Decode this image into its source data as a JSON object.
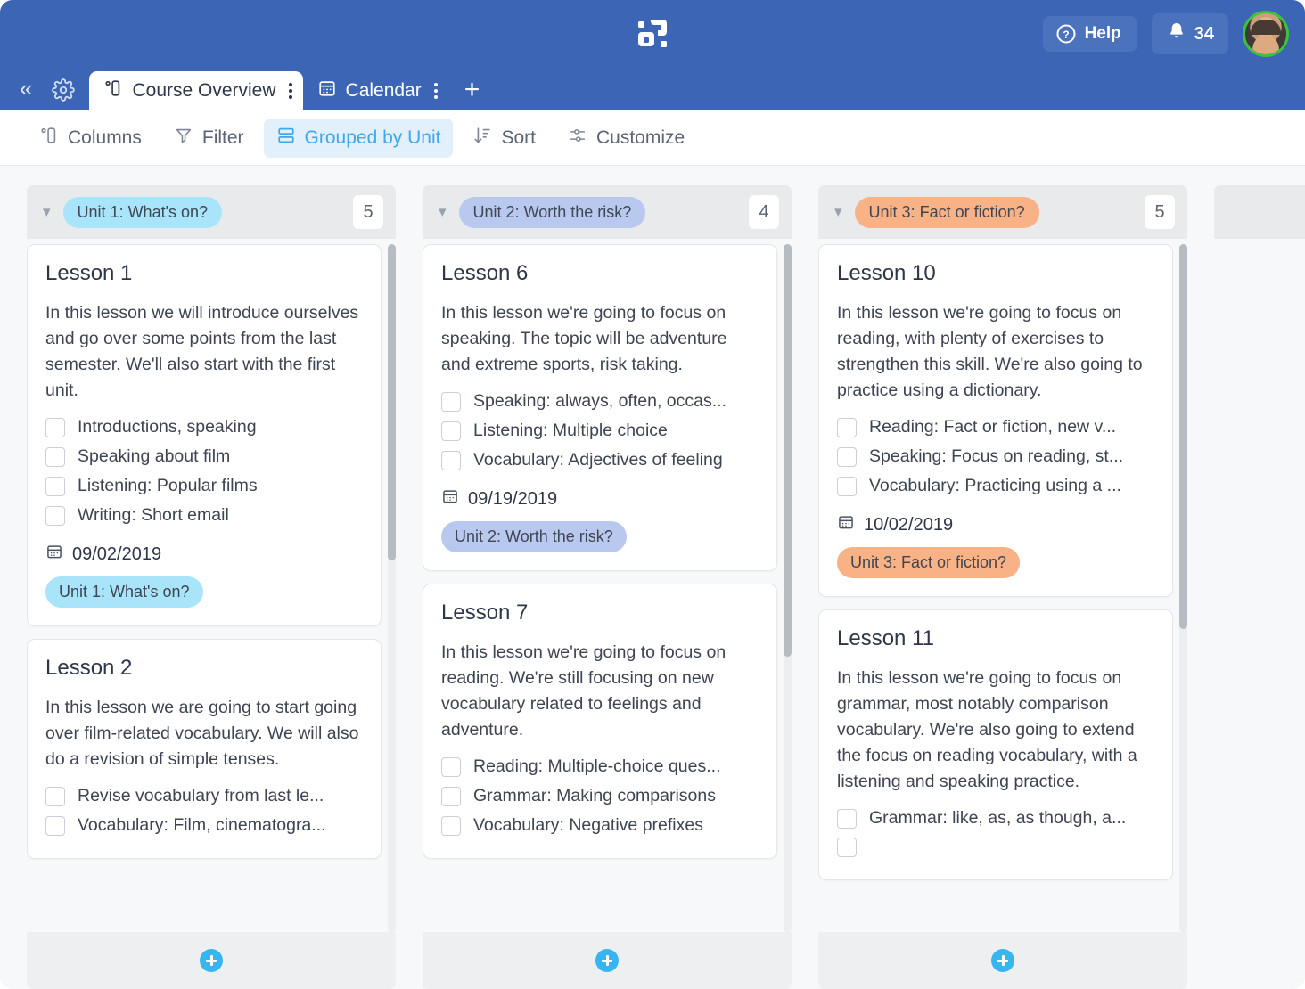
{
  "header": {
    "logo_name": "app-logo",
    "help_label": "Help",
    "notification_count": "34",
    "avatar_name": "user-avatar"
  },
  "tabs": {
    "collapse_label": "«",
    "settings_icon": "gear-icon",
    "items": [
      {
        "label": "Course Overview",
        "icon": "board-view-icon",
        "active": true
      },
      {
        "label": "Calendar",
        "icon": "calendar-view-icon",
        "active": false
      }
    ],
    "add_tab_label": "+"
  },
  "toolbar": {
    "items": [
      {
        "label": "Columns",
        "icon": "columns-icon",
        "active": false
      },
      {
        "label": "Filter",
        "icon": "filter-icon",
        "active": false
      },
      {
        "label": "Grouped by Unit",
        "icon": "group-icon",
        "active": true
      },
      {
        "label": "Sort",
        "icon": "sort-icon",
        "active": false
      },
      {
        "label": "Customize",
        "icon": "customize-icon",
        "active": false
      }
    ]
  },
  "colors": {
    "header_blue": "#3c66b5",
    "accent_blue": "#36b5f0",
    "unit1_pill": "#a8e4fa",
    "unit2_pill": "#b9c8ee",
    "unit3_pill": "#f9b186"
  },
  "board": {
    "groups": [
      {
        "name": "Unit 1: What's on?",
        "pill_color": "#a8e4fa",
        "count": "5",
        "scroll_thumb_top_pct": 0,
        "scroll_thumb_height_pct": 46,
        "cards": [
          {
            "title": "Lesson 1",
            "description": "In this lesson we will introduce ourselves and go over some points from the last semester. We'll also start with the first unit.",
            "checklist": [
              "Introductions, speaking",
              "Speaking about film",
              "Listening: Popular films",
              "Writing: Short email"
            ],
            "date": "09/02/2019",
            "pill": "Unit 1: What's on?",
            "pill_color": "#a8e4fa"
          },
          {
            "title": "Lesson 2",
            "description": "In this lesson we are going to start going over film-related vocabulary. We will also do a revision of simple tenses.",
            "checklist": [
              "Revise vocabulary from last le...",
              "Vocabulary: Film, cinematogra..."
            ],
            "date": "",
            "pill": "",
            "pill_color": ""
          }
        ]
      },
      {
        "name": "Unit 2: Worth the risk?",
        "pill_color": "#b9c8ee",
        "count": "4",
        "scroll_thumb_top_pct": 0,
        "scroll_thumb_height_pct": 60,
        "cards": [
          {
            "title": "Lesson 6",
            "description": "In this lesson we're going to focus on speaking. The topic will be adventure and extreme sports, risk taking.",
            "checklist": [
              "Speaking: always, often, occas...",
              "Listening: Multiple choice",
              "Vocabulary: Adjectives of feeling"
            ],
            "date": "09/19/2019",
            "pill": "Unit 2: Worth the risk?",
            "pill_color": "#b9c8ee"
          },
          {
            "title": "Lesson 7",
            "description": "In this lesson we're going to focus on reading. We're still focusing on new vocabulary related to feelings and adventure.",
            "checklist": [
              "Reading: Multiple-choice ques...",
              "Grammar: Making comparisons",
              "Vocabulary: Negative prefixes"
            ],
            "date": "",
            "pill": "",
            "pill_color": ""
          }
        ]
      },
      {
        "name": "Unit 3: Fact or fiction?",
        "pill_color": "#f9b186",
        "count": "5",
        "scroll_thumb_top_pct": 0,
        "scroll_thumb_height_pct": 56,
        "cards": [
          {
            "title": "Lesson 10",
            "description": "In this lesson we're going to focus on reading, with plenty of exercises to strengthen this skill. We're also going to practice using a dictionary.",
            "checklist": [
              "Reading: Fact or fiction, new v...",
              "Speaking: Focus on reading, st...",
              "Vocabulary: Practicing using a ..."
            ],
            "date": "10/02/2019",
            "pill": "Unit 3: Fact or fiction?",
            "pill_color": "#f9b186"
          },
          {
            "title": "Lesson 11",
            "description": "In this lesson we're going to focus on grammar, most notably comparison vocabulary. We're also going to extend the focus on reading vocabulary, with a listening and speaking practice.",
            "checklist": [
              "Grammar: like, as, as though, a..."
            ],
            "date": "",
            "pill": "",
            "pill_color": ""
          }
        ]
      }
    ],
    "add_card_label": "add-card",
    "add_group_label": "add-group"
  }
}
